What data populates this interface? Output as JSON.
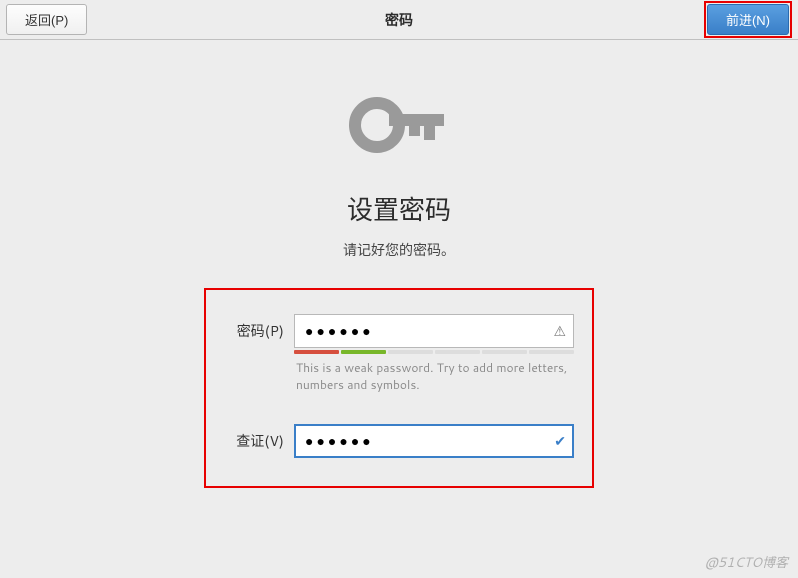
{
  "header": {
    "back": "返回(P)",
    "title": "密码",
    "next": "前进(N)"
  },
  "main": {
    "heading": "设置密码",
    "subheading": "请记好您的密码。"
  },
  "form": {
    "password_label": "密码(P)",
    "password_value": "●●●●●●",
    "strength_hint": "This is a weak password. Try to add more letters, numbers and symbols.",
    "verify_label": "查证(V)",
    "verify_value": "●●●●●●"
  },
  "icons": {
    "warn": "⚠",
    "check": "✔"
  },
  "watermark": "@51CTO博客"
}
